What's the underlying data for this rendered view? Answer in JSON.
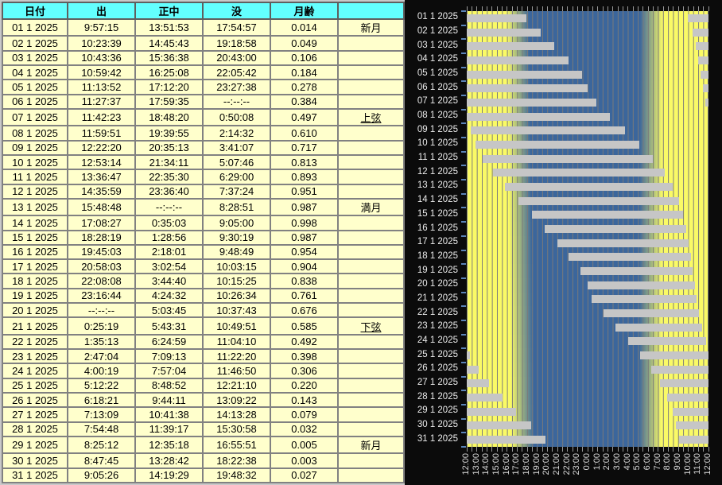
{
  "table": {
    "headers": [
      "日付",
      "出",
      "正中",
      "没",
      "月齢",
      ""
    ],
    "rows": [
      {
        "date": "01 1 2025",
        "rise": "9:57:15",
        "transit": "13:51:53",
        "set": "17:54:57",
        "age": "0.014",
        "phase": "新月",
        "underline": false
      },
      {
        "date": "02 1 2025",
        "rise": "10:23:39",
        "transit": "14:45:43",
        "set": "19:18:58",
        "age": "0.049",
        "phase": "",
        "underline": false
      },
      {
        "date": "03 1 2025",
        "rise": "10:43:36",
        "transit": "15:36:38",
        "set": "20:43:00",
        "age": "0.106",
        "phase": "",
        "underline": false
      },
      {
        "date": "04 1 2025",
        "rise": "10:59:42",
        "transit": "16:25:08",
        "set": "22:05:42",
        "age": "0.184",
        "phase": "",
        "underline": false
      },
      {
        "date": "05 1 2025",
        "rise": "11:13:52",
        "transit": "17:12:20",
        "set": "23:27:38",
        "age": "0.278",
        "phase": "",
        "underline": false
      },
      {
        "date": "06 1 2025",
        "rise": "11:27:37",
        "transit": "17:59:35",
        "set": "--:--:--",
        "age": "0.384",
        "phase": "",
        "underline": false
      },
      {
        "date": "07 1 2025",
        "rise": "11:42:23",
        "transit": "18:48:20",
        "set": "0:50:08",
        "age": "0.497",
        "phase": "上弦",
        "underline": true
      },
      {
        "date": "08 1 2025",
        "rise": "11:59:51",
        "transit": "19:39:55",
        "set": "2:14:32",
        "age": "0.610",
        "phase": "",
        "underline": false
      },
      {
        "date": "09 1 2025",
        "rise": "12:22:20",
        "transit": "20:35:13",
        "set": "3:41:07",
        "age": "0.717",
        "phase": "",
        "underline": false
      },
      {
        "date": "10 1 2025",
        "rise": "12:53:14",
        "transit": "21:34:11",
        "set": "5:07:46",
        "age": "0.813",
        "phase": "",
        "underline": false
      },
      {
        "date": "11 1 2025",
        "rise": "13:36:47",
        "transit": "22:35:30",
        "set": "6:29:00",
        "age": "0.893",
        "phase": "",
        "underline": false
      },
      {
        "date": "12 1 2025",
        "rise": "14:35:59",
        "transit": "23:36:40",
        "set": "7:37:24",
        "age": "0.951",
        "phase": "",
        "underline": false
      },
      {
        "date": "13 1 2025",
        "rise": "15:48:48",
        "transit": "--:--:--",
        "set": "8:28:51",
        "age": "0.987",
        "phase": "満月",
        "underline": false
      },
      {
        "date": "14 1 2025",
        "rise": "17:08:27",
        "transit": "0:35:03",
        "set": "9:05:00",
        "age": "0.998",
        "phase": "",
        "underline": false
      },
      {
        "date": "15 1 2025",
        "rise": "18:28:19",
        "transit": "1:28:56",
        "set": "9:30:19",
        "age": "0.987",
        "phase": "",
        "underline": false
      },
      {
        "date": "16 1 2025",
        "rise": "19:45:03",
        "transit": "2:18:01",
        "set": "9:48:49",
        "age": "0.954",
        "phase": "",
        "underline": false
      },
      {
        "date": "17 1 2025",
        "rise": "20:58:03",
        "transit": "3:02:54",
        "set": "10:03:15",
        "age": "0.904",
        "phase": "",
        "underline": false
      },
      {
        "date": "18 1 2025",
        "rise": "22:08:08",
        "transit": "3:44:40",
        "set": "10:15:25",
        "age": "0.838",
        "phase": "",
        "underline": false
      },
      {
        "date": "19 1 2025",
        "rise": "23:16:44",
        "transit": "4:24:32",
        "set": "10:26:34",
        "age": "0.761",
        "phase": "",
        "underline": false
      },
      {
        "date": "20 1 2025",
        "rise": "--:--:--",
        "transit": "5:03:45",
        "set": "10:37:43",
        "age": "0.676",
        "phase": "",
        "underline": false
      },
      {
        "date": "21 1 2025",
        "rise": "0:25:19",
        "transit": "5:43:31",
        "set": "10:49:51",
        "age": "0.585",
        "phase": "下弦",
        "underline": true
      },
      {
        "date": "22 1 2025",
        "rise": "1:35:13",
        "transit": "6:24:59",
        "set": "11:04:10",
        "age": "0.492",
        "phase": "",
        "underline": false
      },
      {
        "date": "23 1 2025",
        "rise": "2:47:04",
        "transit": "7:09:13",
        "set": "11:22:20",
        "age": "0.398",
        "phase": "",
        "underline": false
      },
      {
        "date": "24 1 2025",
        "rise": "4:00:19",
        "transit": "7:57:04",
        "set": "11:46:50",
        "age": "0.306",
        "phase": "",
        "underline": false
      },
      {
        "date": "25 1 2025",
        "rise": "5:12:22",
        "transit": "8:48:52",
        "set": "12:21:10",
        "age": "0.220",
        "phase": "",
        "underline": false
      },
      {
        "date": "26 1 2025",
        "rise": "6:18:21",
        "transit": "9:44:11",
        "set": "13:09:22",
        "age": "0.143",
        "phase": "",
        "underline": false
      },
      {
        "date": "27 1 2025",
        "rise": "7:13:09",
        "transit": "10:41:38",
        "set": "14:13:28",
        "age": "0.079",
        "phase": "",
        "underline": false
      },
      {
        "date": "28 1 2025",
        "rise": "7:54:48",
        "transit": "11:39:17",
        "set": "15:30:58",
        "age": "0.032",
        "phase": "",
        "underline": false
      },
      {
        "date": "29 1 2025",
        "rise": "8:25:12",
        "transit": "12:35:18",
        "set": "16:55:51",
        "age": "0.005",
        "phase": "新月",
        "underline": false
      },
      {
        "date": "30 1 2025",
        "rise": "8:47:45",
        "transit": "13:28:42",
        "set": "18:22:38",
        "age": "0.003",
        "phase": "",
        "underline": false
      },
      {
        "date": "31 1 2025",
        "rise": "9:05:26",
        "transit": "14:19:29",
        "set": "19:48:32",
        "age": "0.027",
        "phase": "",
        "underline": false
      }
    ]
  },
  "chart_data": {
    "type": "bar",
    "subtype": "moon-above-horizon-gantt",
    "title": "",
    "x_axis_hours_after_noon": [
      0,
      24
    ],
    "x_tick_labels": [
      "12:00",
      "13:00",
      "14:00",
      "15:00",
      "16:00",
      "17:00",
      "18:00",
      "19:00",
      "20:00",
      "21:00",
      "22:00",
      "23:00",
      "0:00",
      "1:00",
      "2:00",
      "3:00",
      "4:00",
      "5:00",
      "6:00",
      "7:00",
      "8:00",
      "9:00",
      "10:00",
      "11:00",
      "12:00"
    ],
    "gridline_interval_hours": 0.5,
    "y_categories": [
      "01 1 2025",
      "02 1 2025",
      "03 1 2025",
      "04 1 2025",
      "05 1 2025",
      "06 1 2025",
      "07 1 2025",
      "08 1 2025",
      "09 1 2025",
      "10 1 2025",
      "11 1 2025",
      "12 1 2025",
      "13 1 2025",
      "14 1 2025",
      "15 1 2025",
      "16 1 2025",
      "17 1 2025",
      "18 1 2025",
      "19 1 2025",
      "20 1 2025",
      "21 1 2025",
      "22 1 2025",
      "23 1 2025",
      "24 1 2025",
      "25 1 2025",
      "26 1 2025",
      "27 1 2025",
      "28 1 2025",
      "29 1 2025",
      "30 1 2025",
      "31 1 2025"
    ],
    "bars_hours_after_noon": [
      [
        [
          0,
          5.916
        ],
        [
          21.954,
          24
        ]
      ],
      [
        [
          0,
          7.316
        ],
        [
          22.394,
          24
        ]
      ],
      [
        [
          0,
          8.717
        ],
        [
          22.727,
          24
        ]
      ],
      [
        [
          0,
          10.095
        ],
        [
          22.995,
          24
        ]
      ],
      [
        [
          0,
          11.461
        ],
        [
          23.231,
          24
        ]
      ],
      [
        [
          0,
          12.0
        ],
        [
          23.46,
          24
        ]
      ],
      [
        [
          0,
          12.836
        ],
        [
          23.706,
          24
        ]
      ],
      [
        [
          0,
          14.242
        ],
        [
          23.998,
          24
        ]
      ],
      [
        [
          0.372,
          15.685
        ]
      ],
      [
        [
          0.887,
          17.129
        ]
      ],
      [
        [
          1.613,
          18.483
        ]
      ],
      [
        [
          2.6,
          19.624
        ]
      ],
      [
        [
          3.813,
          20.481
        ]
      ],
      [
        [
          5.141,
          21.083
        ]
      ],
      [
        [
          6.472,
          21.505
        ]
      ],
      [
        [
          7.751,
          21.814
        ]
      ],
      [
        [
          8.968,
          22.054
        ]
      ],
      [
        [
          10.136,
          22.257
        ]
      ],
      [
        [
          11.279,
          22.443
        ]
      ],
      [
        [
          12.0,
          22.629
        ]
      ],
      [
        [
          12.422,
          22.831
        ]
      ],
      [
        [
          13.587,
          23.069
        ]
      ],
      [
        [
          14.784,
          23.372
        ]
      ],
      [
        [
          16.005,
          23.781
        ]
      ],
      [
        [
          0,
          0.353
        ],
        [
          17.206,
          24
        ]
      ],
      [
        [
          0,
          1.156
        ],
        [
          18.306,
          24
        ]
      ],
      [
        [
          0,
          2.225
        ],
        [
          19.219,
          24
        ]
      ],
      [
        [
          0,
          3.516
        ],
        [
          19.913,
          24
        ]
      ],
      [
        [
          0,
          4.931
        ],
        [
          20.42,
          24
        ]
      ],
      [
        [
          0,
          6.377
        ],
        [
          20.796,
          24
        ]
      ],
      [
        [
          0,
          7.809
        ],
        [
          21.09,
          24
        ]
      ]
    ],
    "daylight": {
      "sunset_pos_first_day": 4.63,
      "sunset_pos_last_day": 5.13,
      "sunrise_pos_first_day": 18.85,
      "sunrise_pos_last_day": 18.7,
      "twilight_before_h": 0.7,
      "twilight_after_h": 1.6
    },
    "legend": "none",
    "colors": {
      "day": "#fafa66",
      "night": "#3b669c",
      "bar": "#c6c6c6",
      "grid": "#7a7a7a",
      "background": "#0b0b0b",
      "axis_text": "#e6e6e6",
      "y_tick": "#5b84b8",
      "table_header_bg": "#63ffff",
      "table_row_bg": "#ffffcc"
    }
  }
}
